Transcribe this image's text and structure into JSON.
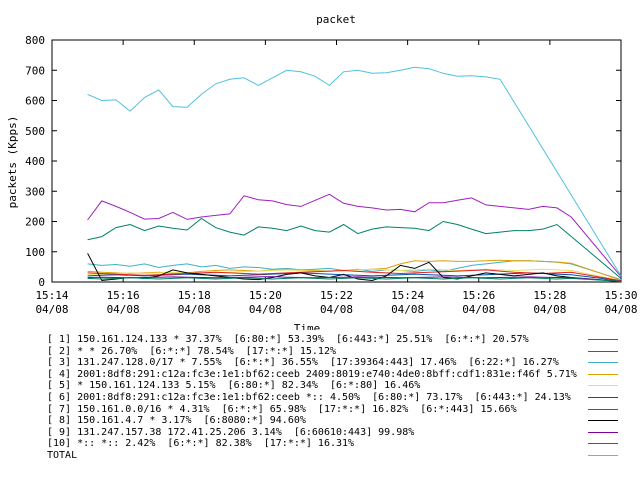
{
  "chart_data": {
    "type": "line",
    "title": "packet",
    "xlabel": "Time",
    "ylabel": "packets (Kpps)",
    "ylim": [
      0,
      800
    ],
    "yticks": [
      "0",
      "100",
      "200",
      "300",
      "400",
      "500",
      "600",
      "700",
      "800"
    ],
    "xlim": [
      "15:14",
      "15:30"
    ],
    "xticks": [
      {
        "time": "15:14",
        "date": "04/08"
      },
      {
        "time": "15:16",
        "date": "04/08"
      },
      {
        "time": "15:18",
        "date": "04/08"
      },
      {
        "time": "15:20",
        "date": "04/08"
      },
      {
        "time": "15:22",
        "date": "04/08"
      },
      {
        "time": "15:24",
        "date": "04/08"
      },
      {
        "time": "15:26",
        "date": "04/08"
      },
      {
        "time": "15:28",
        "date": "04/08"
      },
      {
        "time": "15:30",
        "date": "04/08"
      }
    ],
    "grid": false,
    "legend_position": "bottom",
    "x": [
      "15:15:00",
      "15:15:24",
      "15:15:48",
      "15:16:12",
      "15:16:36",
      "15:17:00",
      "15:17:24",
      "15:17:48",
      "15:18:12",
      "15:18:36",
      "15:19:00",
      "15:19:24",
      "15:19:48",
      "15:20:12",
      "15:20:36",
      "15:21:00",
      "15:21:24",
      "15:21:48",
      "15:22:12",
      "15:22:36",
      "15:23:00",
      "15:23:24",
      "15:23:48",
      "15:24:12",
      "15:24:36",
      "15:25:00",
      "15:25:24",
      "15:25:48",
      "15:26:12",
      "15:26:36",
      "15:27:00",
      "15:27:24",
      "15:27:48",
      "15:28:12",
      "15:28:36",
      "15:29:00",
      "15:29:24",
      "15:29:48",
      "15:30:00"
    ],
    "series": [
      {
        "name": "[ 1] 150.161.124.133 * 37.37%  [6:80:*] 53.39%  [6:443:*] 25.51%  [6:*:*] 20.57%",
        "color": "#a020c0",
        "values": [
          205,
          268,
          250,
          230,
          208,
          210,
          230,
          207,
          215,
          220,
          225,
          285,
          272,
          268,
          256,
          250,
          270,
          290,
          260,
          250,
          245,
          238,
          240,
          232,
          262,
          262,
          270,
          278,
          255,
          250,
          245,
          240,
          250,
          245,
          215,
          18
        ]
      },
      {
        "name": "[ 2] * * 26.70%  [6:*:*] 78.54%  [17:*:*] 15.12%",
        "color": "#00806a",
        "values": [
          140,
          150,
          180,
          190,
          170,
          185,
          178,
          172,
          210,
          180,
          165,
          155,
          182,
          178,
          170,
          185,
          170,
          165,
          190,
          160,
          175,
          182,
          180,
          178,
          170,
          200,
          190,
          175,
          160,
          165,
          170,
          170,
          175,
          190,
          12
        ]
      },
      {
        "name": "[ 3] 131.247.128.0/17 * 7.55%  [6:*:*] 36.55%  [17:39364:443] 17.46%  [6:22:*] 16.27%",
        "color": "#40b0c8",
        "values": [
          60,
          55,
          58,
          52,
          60,
          48,
          55,
          60,
          50,
          55,
          45,
          50,
          48,
          42,
          45,
          40,
          42,
          45,
          38,
          42,
          35,
          40,
          38,
          35,
          40,
          35,
          45,
          55,
          60,
          65,
          70,
          70,
          68,
          65,
          60,
          8
        ]
      },
      {
        "name": "[ 4] 2001:8df8:291:c12a:fc3e:1e1:bf62:ceeb 2409:8019:e740:4de0:8bff:cdf1:831e:f46f 5.71%",
        "color": "#e0a000",
        "values": [
          35,
          32,
          30,
          28,
          30,
          32,
          28,
          30,
          35,
          38,
          40,
          38,
          36,
          40,
          42,
          40,
          38,
          36,
          38,
          40,
          42,
          45,
          60,
          70,
          68,
          70,
          68,
          68,
          70,
          72,
          70,
          70,
          68,
          66,
          62,
          6
        ]
      },
      {
        "name": "[ 5] * 150.161.124.133 5.15%  [6:80:*] 82.34%  [6:*:80] 16.46%",
        "color": "#e8e060",
        "values": [
          25,
          26,
          28,
          30,
          28,
          30,
          32,
          30,
          28,
          30,
          32,
          34,
          36,
          38,
          40,
          38,
          36,
          35,
          38,
          40,
          42,
          40,
          38,
          40,
          42,
          40,
          38,
          40,
          42,
          40,
          38,
          40,
          42,
          40,
          38,
          5
        ]
      },
      {
        "name": "[ 6] 2001:8df8:291:c12a:fc3e:1e1:bf62:ceeb *:: 4.50%  [6:80:*] 73.17%  [6:443:*] 24.13%",
        "color": "#0050b0",
        "values": [
          20,
          22,
          24,
          22,
          20,
          22,
          24,
          26,
          24,
          22,
          20,
          22,
          24,
          26,
          28,
          30,
          28,
          26,
          24,
          22,
          20,
          22,
          24,
          26,
          24,
          22,
          20,
          22,
          24,
          26,
          28,
          30,
          28,
          26,
          24,
          4
        ]
      },
      {
        "name": "[ 7] 150.161.0.0/16 * 4.31%  [6:*:*] 65.98%  [17:*:*] 16.82%  [6:*:443] 15.66%",
        "color": "#e02020",
        "values": [
          30,
          28,
          26,
          24,
          22,
          24,
          26,
          28,
          30,
          32,
          30,
          28,
          26,
          28,
          30,
          32,
          34,
          36,
          38,
          35,
          32,
          30,
          28,
          30,
          32,
          34,
          36,
          38,
          40,
          36,
          32,
          30,
          28,
          30,
          32,
          4
        ]
      },
      {
        "name": "[ 8] 150.161.4.7 * 3.17%  [6:8080:*] 94.60%",
        "color": "#000000",
        "values": [
          95,
          5,
          10,
          15,
          12,
          20,
          40,
          30,
          25,
          20,
          15,
          10,
          8,
          15,
          25,
          30,
          20,
          15,
          25,
          10,
          5,
          20,
          55,
          45,
          65,
          15,
          10,
          20,
          30,
          25,
          20,
          25,
          30,
          20,
          15,
          2
        ]
      },
      {
        "name": "[ 9] 131.247.157.38 172.41.25.206 3.14%  [6:60610:443] 99.98%",
        "color": "#8000a0",
        "values": [
          15,
          16,
          15,
          14,
          15,
          16,
          17,
          16,
          15,
          14,
          15,
          16,
          17,
          18,
          16,
          15,
          14,
          15,
          16,
          17,
          16,
          15,
          14,
          15,
          16,
          17,
          16,
          15,
          14,
          15,
          16,
          17,
          16,
          15,
          14,
          2
        ]
      },
      {
        "name": "[10] *:: *:: 2.42%  [6:*:*] 82.38%  [17:*:*] 16.31%",
        "color": "#008060",
        "values": [
          12,
          10,
          12,
          14,
          12,
          10,
          12,
          14,
          12,
          10,
          12,
          14,
          12,
          10,
          12,
          14,
          12,
          10,
          12,
          14,
          12,
          10,
          12,
          14,
          12,
          10,
          12,
          14,
          12,
          10,
          12,
          14,
          12,
          10,
          12,
          2
        ]
      },
      {
        "name": "TOTAL",
        "color": "#50c0e0",
        "values": [
          620,
          600,
          602,
          565,
          610,
          635,
          580,
          578,
          620,
          655,
          670,
          675,
          650,
          675,
          700,
          695,
          680,
          650,
          695,
          700,
          690,
          692,
          700,
          710,
          705,
          690,
          680,
          682,
          678,
          670,
          20
        ]
      }
    ]
  }
}
